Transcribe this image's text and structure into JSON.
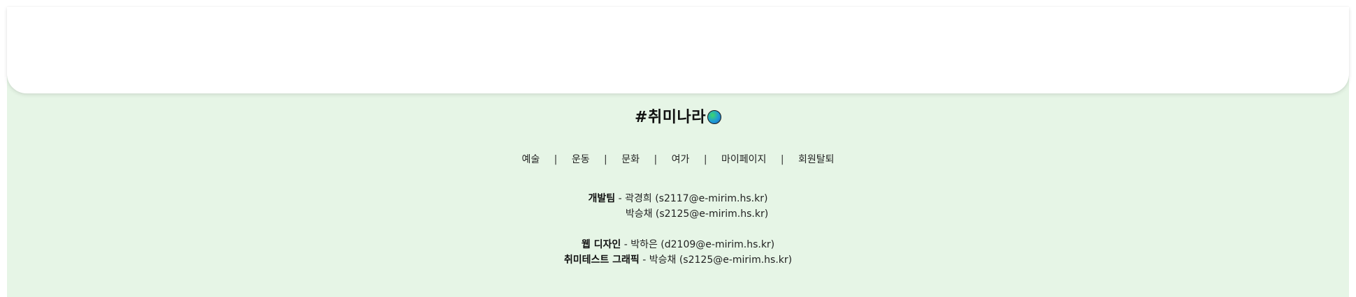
{
  "logo": {
    "text": "#취미나라",
    "icon": "globe-icon"
  },
  "nav": {
    "items": [
      "예술",
      "운동",
      "문화",
      "여가",
      "마이페이지",
      "회원탈퇴"
    ],
    "separator": "|"
  },
  "credits": {
    "dev_team_label": "개발팀",
    "dev_member_1": "- 곽경희 (s2117@e-mirim.hs.kr)",
    "dev_member_2": "박승채 (s2125@e-mirim.hs.kr)",
    "web_design_label": "웹 디자인",
    "web_design_member": "- 박하은 (d2109@e-mirim.hs.kr)",
    "test_graphic_label": "취미테스트 그래픽",
    "test_graphic_member": "- 박승채 (s2125@e-mirim.hs.kr)"
  },
  "colors": {
    "footer_background": "#e6f5e6",
    "card_background": "#ffffff"
  }
}
